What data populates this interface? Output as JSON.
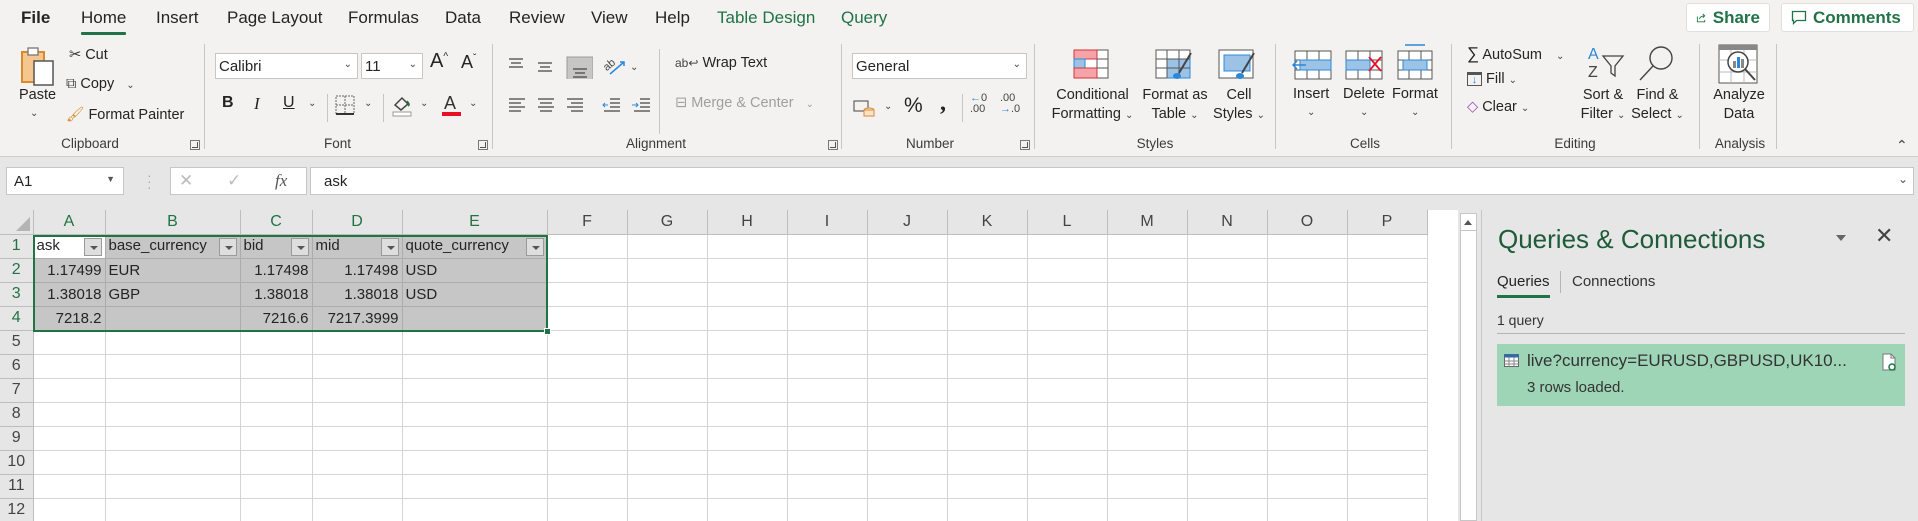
{
  "tabs": {
    "file": "File",
    "items": [
      {
        "label": "Home",
        "active": true,
        "contextual": false
      },
      {
        "label": "Insert",
        "active": false,
        "contextual": false
      },
      {
        "label": "Page Layout",
        "active": false,
        "contextual": false
      },
      {
        "label": "Formulas",
        "active": false,
        "contextual": false
      },
      {
        "label": "Data",
        "active": false,
        "contextual": false
      },
      {
        "label": "Review",
        "active": false,
        "contextual": false
      },
      {
        "label": "View",
        "active": false,
        "contextual": false
      },
      {
        "label": "Help",
        "active": false,
        "contextual": false
      },
      {
        "label": "Table Design",
        "active": false,
        "contextual": true
      },
      {
        "label": "Query",
        "active": false,
        "contextual": true
      }
    ],
    "share": "Share",
    "comments": "Comments"
  },
  "ribbon": {
    "clipboard": {
      "label": "Clipboard",
      "paste": "Paste",
      "cut": "Cut",
      "copy": "Copy",
      "format_painter": "Format Painter"
    },
    "font": {
      "label": "Font",
      "font_name": "Calibri",
      "font_size": "11",
      "bold": "B",
      "italic": "I",
      "underline": "U",
      "font_color": "#e81123"
    },
    "alignment": {
      "label": "Alignment",
      "wrap_text": "Wrap Text",
      "merge_center": "Merge & Center"
    },
    "number": {
      "label": "Number",
      "format": "General",
      "percent": "%",
      "comma": "9"
    },
    "styles": {
      "label": "Styles",
      "conditional_formatting": [
        "Conditional",
        "Formatting"
      ],
      "format_as_table": [
        "Format as",
        "Table"
      ],
      "cell_styles": [
        "Cell",
        "Styles"
      ]
    },
    "cells": {
      "label": "Cells",
      "insert": "Insert",
      "delete": "Delete",
      "format": "Format"
    },
    "editing": {
      "label": "Editing",
      "autosum": "AutoSum",
      "fill": "Fill",
      "clear": "Clear",
      "sort_filter": [
        "Sort &",
        "Filter"
      ],
      "find_select": [
        "Find &",
        "Select"
      ]
    },
    "analysis": {
      "label": "Analysis",
      "analyze_data": [
        "Analyze",
        "Data"
      ]
    }
  },
  "formula_bar": {
    "name_box": "A1",
    "fx": "fx",
    "value": "ask"
  },
  "sheet": {
    "columns": [
      "A",
      "B",
      "C",
      "D",
      "E",
      "F",
      "G",
      "H",
      "I",
      "J",
      "K",
      "L",
      "M",
      "N",
      "O",
      "P"
    ],
    "rows": [
      "1",
      "2",
      "3",
      "4",
      "5",
      "6",
      "7",
      "8",
      "9",
      "10",
      "11",
      "12"
    ],
    "table_headers": [
      "ask",
      "base_currency",
      "bid",
      "mid",
      "quote_currency"
    ],
    "table_rows": [
      [
        "1.17499",
        "EUR",
        "1.17498",
        "1.17498",
        "USD"
      ],
      [
        "1.38018",
        "GBP",
        "1.38018",
        "1.38018",
        "USD"
      ],
      [
        "7218.2",
        "",
        "7216.6",
        "7217.3999",
        ""
      ]
    ],
    "active_cell": "A1",
    "selected_range": "A1:E4"
  },
  "pane": {
    "title": "Queries & Connections",
    "tabs": [
      "Queries",
      "Connections"
    ],
    "active_tab": "Queries",
    "count": "1 query",
    "queries": [
      {
        "name": "live?currency=EURUSD,GBPUSD,UK10...",
        "status": "3 rows loaded."
      }
    ],
    "item_color": "#9fd5b7"
  },
  "colors": {
    "accent": "#217346"
  }
}
